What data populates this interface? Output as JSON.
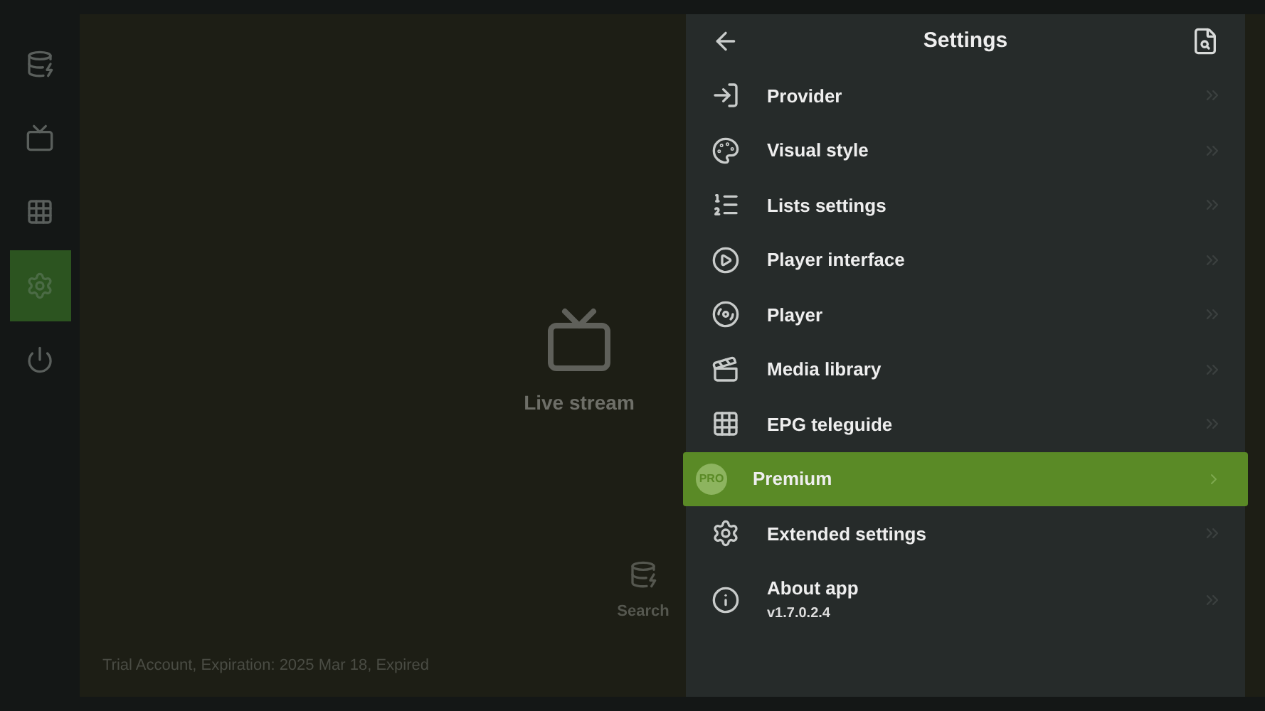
{
  "sidebar": {
    "items": [
      {
        "selected": false
      },
      {
        "selected": false
      },
      {
        "selected": false
      },
      {
        "selected": true
      },
      {
        "selected": false
      }
    ]
  },
  "home": {
    "tiles": [
      {
        "label": "Live stream"
      },
      {
        "label": "Search"
      }
    ],
    "footer": "Trial Account, Expiration: 2025 Mar 18, Expired"
  },
  "settings": {
    "title": "Settings",
    "items": [
      {
        "label": "Provider",
        "selected": false
      },
      {
        "label": "Visual style",
        "selected": false
      },
      {
        "label": "Lists settings",
        "selected": false
      },
      {
        "label": "Player interface",
        "selected": false
      },
      {
        "label": "Player",
        "selected": false
      },
      {
        "label": "Media library",
        "selected": false
      },
      {
        "label": "EPG teleguide",
        "selected": false
      },
      {
        "label": "Premium",
        "badge": "PRO",
        "selected": true
      },
      {
        "label": "Extended settings",
        "selected": false
      },
      {
        "label": "About app",
        "subtitle": "v1.7.0.2.4",
        "selected": false
      }
    ]
  }
}
